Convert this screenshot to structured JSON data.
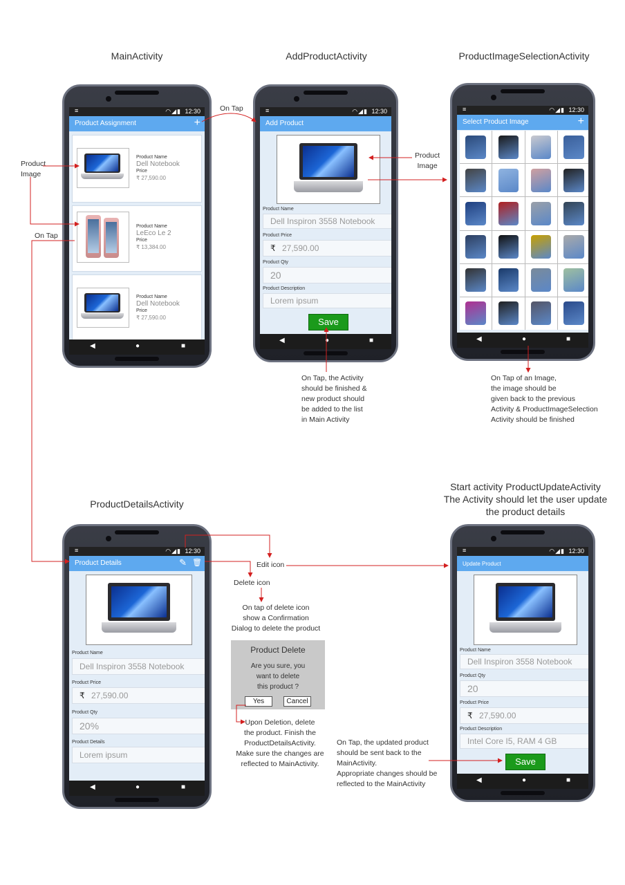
{
  "titles": {
    "main": "MainActivity",
    "add": "AddProductActivity",
    "image_sel": "ProductImageSelectionActivity",
    "details": "ProductDetailsActivity",
    "update_line1": "Start activity ProductUpdateActivity",
    "update_line2": "The Activity should let the user update",
    "update_line3": "the product details"
  },
  "status": {
    "time": "12:30",
    "icons": "◠◢▮",
    "menu": "≡"
  },
  "nav": {
    "back": "◀",
    "home": "●",
    "recent": "■"
  },
  "main_screen": {
    "appbar_title": "Product Assignment",
    "add_icon": "+",
    "items": [
      {
        "name_label": "Product Name",
        "name": "Dell Notebook",
        "price_label": "Price",
        "price": "₹ 27,590.00"
      },
      {
        "name_label": "Product Name",
        "name": "LeEco Le 2",
        "price_label": "Price",
        "price": "₹ 13,384.00"
      },
      {
        "name_label": "Product Name",
        "name": "Dell Notebook",
        "price_label": "Price",
        "price": "₹ 27,590.00"
      }
    ]
  },
  "add_screen": {
    "appbar_title": "Add Product",
    "name_label": "Product Name",
    "name_value": "Dell Inspiron 3558 Notebook",
    "price_label": "Product Price",
    "price_value": "27,590.00",
    "currency": "₹",
    "qty_label": "Product Qty",
    "qty_value": "20",
    "desc_label": "Product Description",
    "desc_value": "Lorem ipsum",
    "save": "Save"
  },
  "image_screen": {
    "appbar_title": "Select Product Image",
    "add_icon": "+"
  },
  "details_screen": {
    "appbar_title": "Product Details",
    "edit_icon": "✎",
    "delete_icon": "🗑",
    "name_label": "Product Name",
    "name_value": "Dell Inspiron 3558 Notebook",
    "price_label": "Product Price",
    "price_value": "27,590.00",
    "currency": "₹",
    "qty_label": "Product Qty",
    "qty_value": "20%",
    "desc_label": "Product Details",
    "desc_value": "Lorem ipsum"
  },
  "update_screen": {
    "appbar_title": "Update Product",
    "name_label": "Product Name",
    "name_value": "Dell Inspiron 3558 Notebook",
    "qty_label": "Product Qty",
    "qty_value": "20",
    "price_label": "Product Price",
    "price_value": "27,590.00",
    "currency": "₹",
    "desc_label": "Product Description",
    "desc_value": "Intel Core I5, RAM 4 GB",
    "save": "Save"
  },
  "dialog": {
    "title": "Product Delete",
    "line1": "Are you sure, you",
    "line2": "want to delete",
    "line3": "this product ?",
    "yes": "Yes",
    "cancel": "Cancel"
  },
  "annotations": {
    "on_tap_top": "On Tap",
    "product_image_left_1": "Product",
    "product_image_left_2": "Image",
    "on_tap_left": "On Tap",
    "product_image_mid_1": "Product",
    "product_image_mid_2": "Image",
    "save_note": [
      "On Tap, the Activity",
      "should be finished &",
      "new product should",
      "be added to the list",
      "in Main Activity"
    ],
    "image_note": [
      "On Tap of an Image,",
      "the image should be",
      "given back to the previous",
      "Activity & ProductImageSelection",
      "Activity should be finished"
    ],
    "edit_icon": "Edit icon",
    "delete_icon": "Delete icon",
    "delete_note": [
      "On tap of delete icon",
      "show a Confirmation",
      "Dialog to delete the product"
    ],
    "deletion_note": [
      "Upon Deletion, delete",
      "the product. Finish the",
      "ProductDetailsActivity.",
      "Make sure the changes are",
      "reflected to MainActivity."
    ],
    "update_note": [
      "On Tap, the updated product",
      "should be sent back to the",
      "MainActivity.",
      "Appropriate changes should be",
      "reflected to the MainActivity"
    ]
  },
  "colors": {
    "appbar": "#5ea9ef",
    "arrow": "#d32020",
    "save": "#1b9a1b"
  }
}
